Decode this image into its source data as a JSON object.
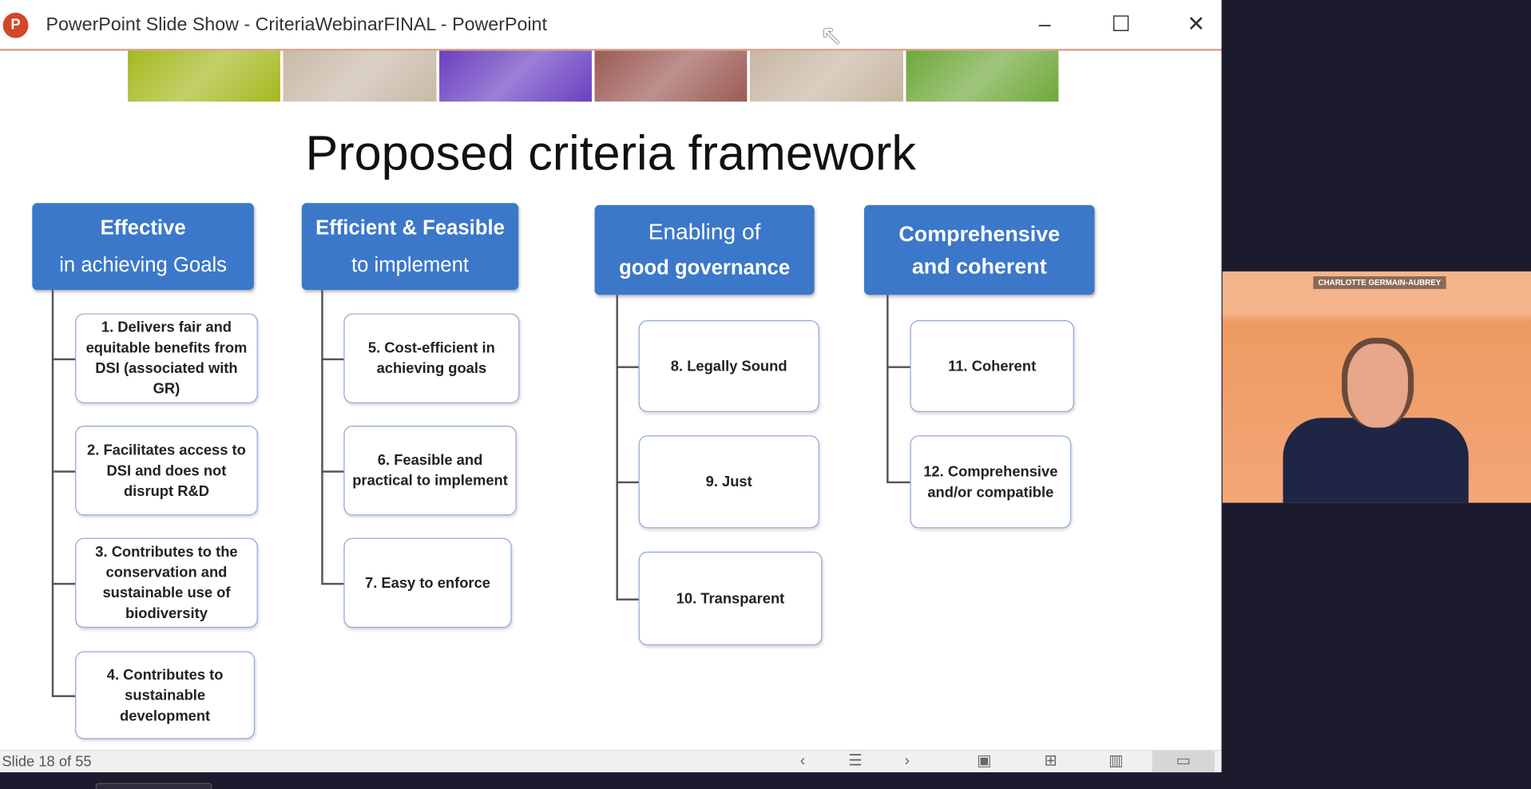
{
  "window": {
    "app_icon": "P",
    "title": "PowerPoint Slide Show  -  CriteriaWebinarFINAL - PowerPoint",
    "controls": {
      "minimize": "–",
      "maximize": "☐",
      "close": "✕"
    }
  },
  "slide": {
    "title": "Proposed criteria framework",
    "strip_colors": [
      "#a5b81e",
      "#c9b9a8",
      "#6a3fc0",
      "#9c5a55",
      "#c8b6a3",
      "#6fa83a"
    ],
    "columns": [
      {
        "head_bold": "Effective",
        "head_normal": "in achieving Goals",
        "items": [
          "1. Delivers fair and equitable benefits from DSI (associated with GR)",
          "2. Facilitates access to DSI and does not disrupt R&D",
          "3. Contributes to the conservation and sustainable use of biodiversity",
          "4. Contributes to sustainable development"
        ]
      },
      {
        "head_bold": "Efficient & Feasible",
        "head_normal": "to implement",
        "items": [
          "5. Cost-efficient in achieving goals",
          "6. Feasible and practical to implement",
          "7. Easy to enforce"
        ]
      },
      {
        "head_normal": "Enabling of",
        "head_bold": "good governance",
        "items": [
          "8. Legally Sound",
          "9. Just",
          "10. Transparent"
        ]
      },
      {
        "head_bold": "Comprehensive",
        "head_bold2": "and coherent",
        "items": [
          "11. Coherent",
          "12. Comprehensive and/or compatible"
        ]
      }
    ],
    "accent_color": "#3b78c9"
  },
  "statusbar": {
    "slide_count": "Slide 18 of 55",
    "icons": [
      "previous-icon",
      "slide-list-icon",
      "next-icon",
      "normal-view-icon",
      "slide-sorter-icon",
      "reading-view-icon",
      "slide-show-icon"
    ]
  },
  "video": {
    "participant_name": "CHARLOTTE GERMAIN-AUBREY"
  }
}
